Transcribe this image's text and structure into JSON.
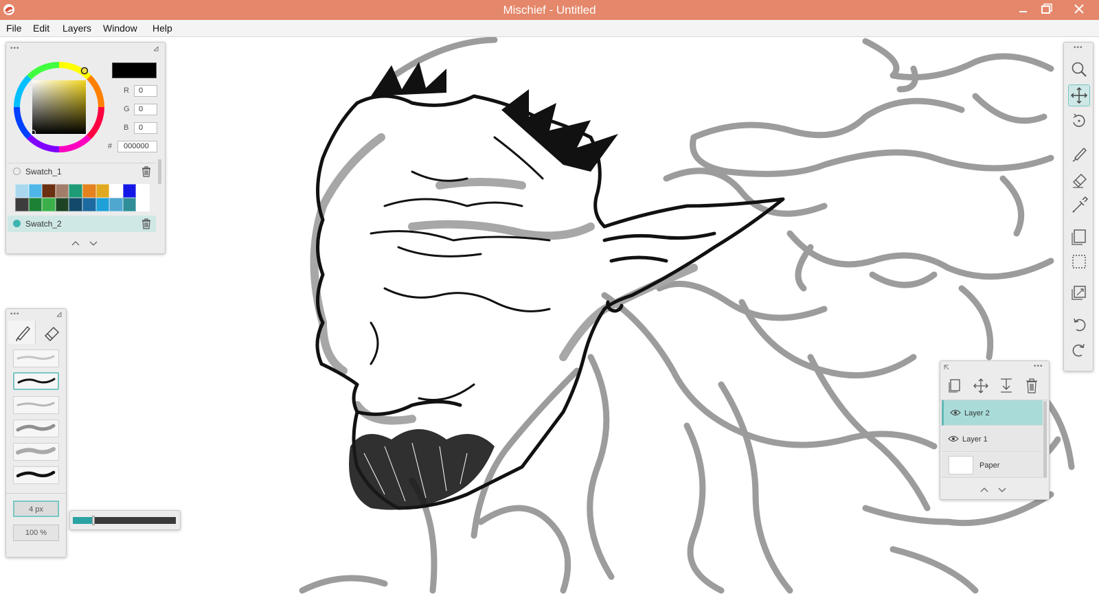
{
  "window": {
    "title": "Mischief - Untitled",
    "title_bar_color": "#e5876a",
    "controls": [
      "minimize-icon",
      "maximize-icon",
      "close-icon"
    ]
  },
  "menu": {
    "items": [
      "File",
      "Edit",
      "Layers",
      "Window",
      "Help"
    ]
  },
  "color_panel": {
    "current_color": "#000000",
    "r_label": "R",
    "r_value": "0",
    "g_label": "G",
    "g_value": "0",
    "b_label": "B",
    "b_value": "0",
    "hex_label": "#",
    "hex_value": "000000",
    "swatch_sets": [
      {
        "name": "Swatch_1",
        "selected": false
      },
      {
        "name": "Swatch_2",
        "selected": true
      }
    ],
    "swatch_colors": [
      "#a9d8ee",
      "#4fb6e8",
      "#6b2f12",
      "#a27d6a",
      "#1e9c77",
      "#e3821f",
      "#e1a91f",
      "#ffffff",
      "#1416e6",
      "#ffffff",
      "#3d3d3d",
      "#1c8134",
      "#3bb04a",
      "#1d4424",
      "#134a6b",
      "#1c6aa0",
      "#1ea0d8",
      "#4fa7d0",
      "#2f8e98",
      "#ffffff"
    ],
    "accent": "#5fb7b2"
  },
  "brush_panel": {
    "tabs": [
      "brush-icon",
      "eraser-icon"
    ],
    "presets": [
      "pencil-light",
      "ink-dark",
      "pencil-soft",
      "airbrush",
      "chalk",
      "marker-bold"
    ],
    "active_preset_index": 1,
    "size_value": "4 px",
    "opacity_value": "100 %",
    "size_slider_fraction": 0.2
  },
  "toolbar": {
    "tools": [
      "zoom-icon",
      "pan-icon",
      "rotate-icon",
      "brush-icon",
      "eraser-icon",
      "eyedropper-icon",
      "new-canvas-icon",
      "selection-icon",
      "resize-canvas-icon",
      "undo-icon",
      "redo-icon"
    ],
    "active_tool": "pan-icon"
  },
  "layers_panel": {
    "tools": [
      "new-layer-icon",
      "move-layer-icon",
      "merge-down-icon",
      "delete-layer-icon"
    ],
    "layers": [
      {
        "name": "Layer 2",
        "visible": true,
        "selected": true
      },
      {
        "name": "Layer 1",
        "visible": true,
        "selected": false
      },
      {
        "name": "Paper",
        "visible": true,
        "selected": false
      }
    ]
  }
}
